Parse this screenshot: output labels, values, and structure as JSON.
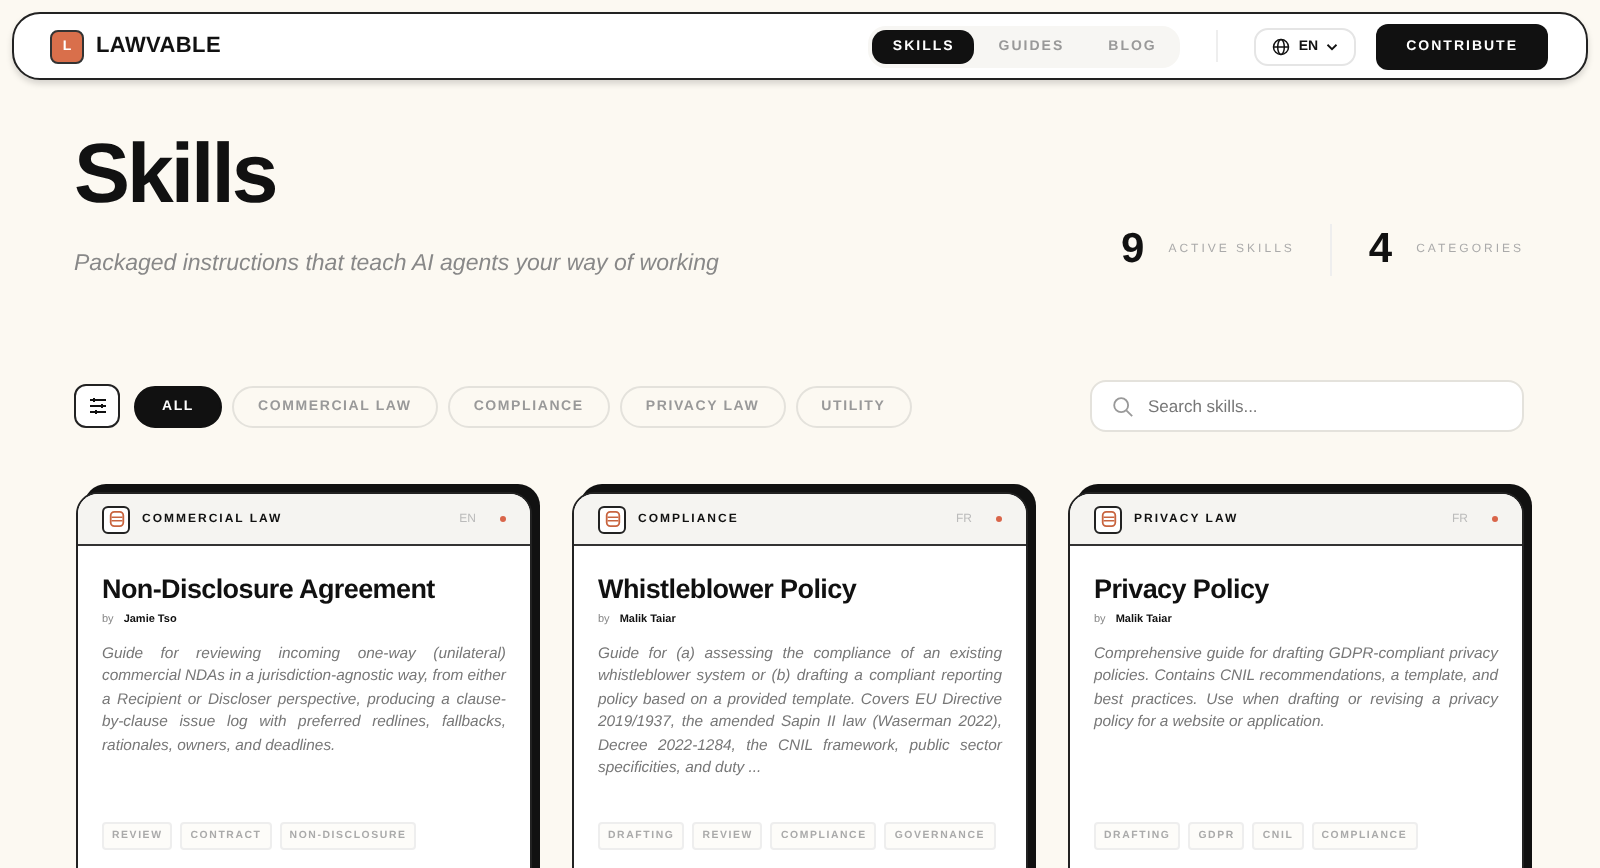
{
  "header": {
    "logo_letter": "L",
    "brand": "LAWVABLE",
    "nav": [
      {
        "label": "SKILLS",
        "selected": true
      },
      {
        "label": "GUIDES",
        "selected": false
      },
      {
        "label": "BLOG",
        "selected": false
      }
    ],
    "language": "EN",
    "cta": "CONTRIBUTE"
  },
  "hero": {
    "title": "Skills",
    "subtitle": "Packaged instructions that teach AI agents your way of working",
    "stats": [
      {
        "value": "9",
        "label": "ACTIVE SKILLS"
      },
      {
        "value": "4",
        "label": "CATEGORIES"
      }
    ]
  },
  "filters": [
    {
      "label": "ALL",
      "selected": true
    },
    {
      "label": "COMMERCIAL LAW",
      "selected": false
    },
    {
      "label": "COMPLIANCE",
      "selected": false
    },
    {
      "label": "PRIVACY LAW",
      "selected": false
    },
    {
      "label": "UTILITY",
      "selected": false
    }
  ],
  "search": {
    "placeholder": "Search skills..."
  },
  "cards": [
    {
      "category": "COMMERCIAL LAW",
      "lang": "EN",
      "title": "Non-Disclosure Agreement",
      "by": "by",
      "author": "Jamie Tso",
      "description": "Guide for reviewing incoming one-way (unilateral) commercial NDAs in a jurisdiction-agnostic way, from either a Recipient or Discloser perspective, producing a clause-by-clause issue log with preferred redlines, fallbacks, rationales, owners, and deadlines.",
      "tags": [
        "REVIEW",
        "CONTRACT",
        "NON-DISCLOSURE"
      ]
    },
    {
      "category": "COMPLIANCE",
      "lang": "FR",
      "title": "Whistleblower Policy",
      "by": "by",
      "author": "Malik Taiar",
      "description": "Guide for (a) assessing the compliance of an existing whistleblower system or (b) drafting a compliant reporting policy based on a provided template. Covers EU Directive 2019/1937, the amended Sapin II law (Waserman 2022), Decree 2022-1284, the CNIL framework, public sector specificities, and duty ...",
      "tags": [
        "DRAFTING",
        "REVIEW",
        "COMPLIANCE",
        "GOVERNANCE"
      ]
    },
    {
      "category": "PRIVACY LAW",
      "lang": "FR",
      "title": "Privacy Policy",
      "by": "by",
      "author": "Malik Taiar",
      "description": "Comprehensive guide for drafting GDPR-compliant privacy policies. Contains CNIL recommendations, a template, and best practices. Use when drafting or revising a privacy policy for a website or application.",
      "tags": [
        "DRAFTING",
        "GDPR",
        "CNIL",
        "COMPLIANCE"
      ]
    }
  ]
}
